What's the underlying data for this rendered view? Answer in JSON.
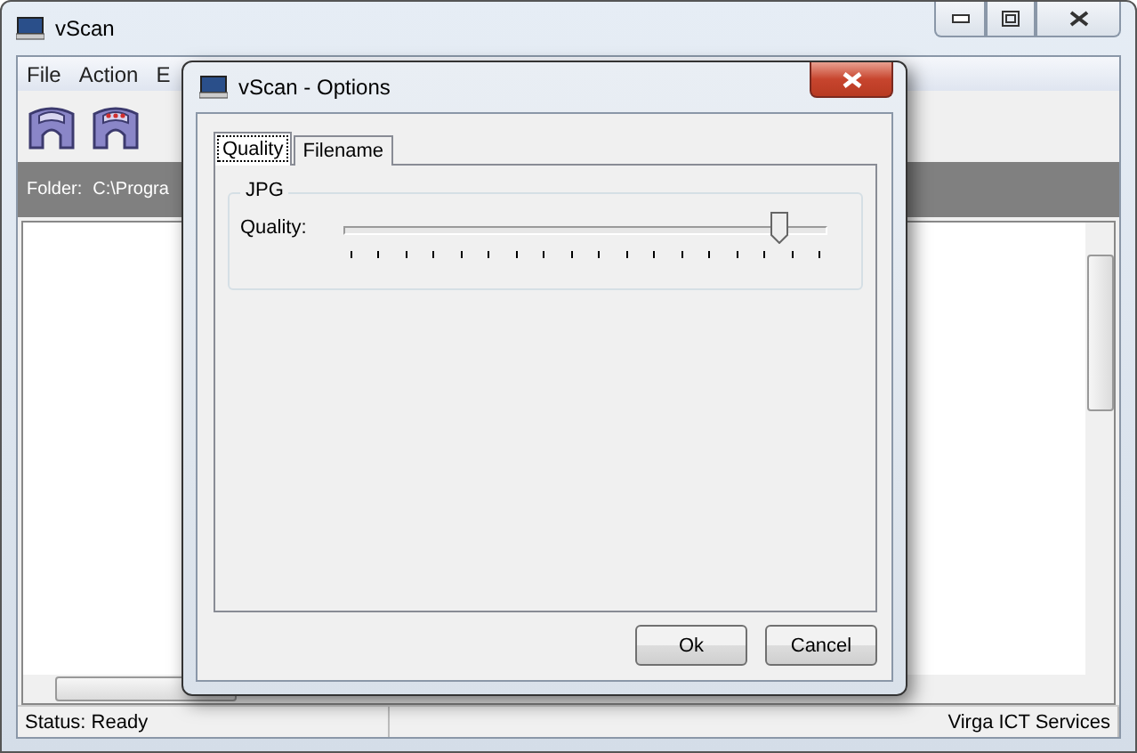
{
  "window": {
    "title": "vScan"
  },
  "menu": [
    {
      "label": "File"
    },
    {
      "label": "Action"
    },
    {
      "label": "E"
    }
  ],
  "folder": {
    "label": "Folder:",
    "path": "C:\\Progra"
  },
  "dialog": {
    "title": "vScan - Options",
    "tabs": [
      {
        "label": "Quality",
        "selected": true
      },
      {
        "label": "Filename",
        "selected": false
      }
    ],
    "group": {
      "title": "JPG",
      "slider": {
        "label": "Quality:",
        "level": 0.9
      }
    },
    "buttons": [
      "Ok",
      "Cancel"
    ]
  },
  "status_bar": [
    "Status: Ready",
    "Virga ICT Services"
  ]
}
